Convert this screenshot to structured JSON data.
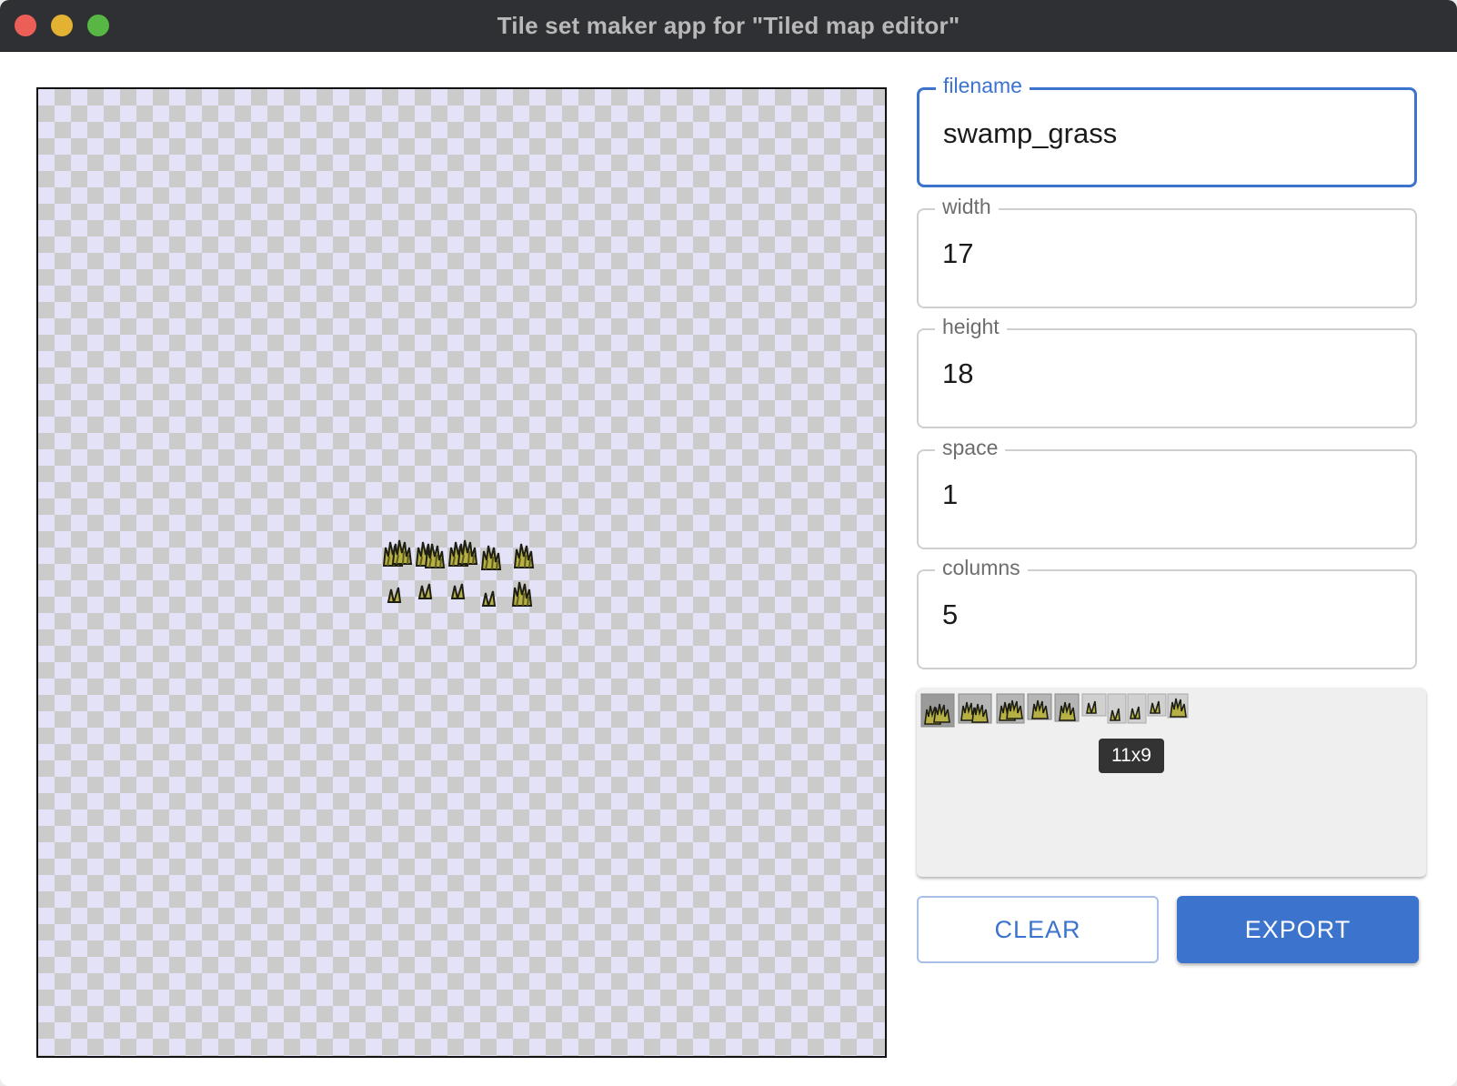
{
  "window": {
    "title": "Tile set maker app for \"Tiled map editor\""
  },
  "canvas": {
    "sprites": [
      "grass-tuft",
      "grass-tuft",
      "grass-tuft",
      "grass-tuft",
      "grass-tuft",
      "grass-sprout",
      "grass-sprout",
      "grass-sprout",
      "grass-sprout",
      "grass-tuft"
    ]
  },
  "form": {
    "filename": {
      "label": "filename",
      "value": "swamp_grass"
    },
    "width": {
      "label": "width",
      "value": "17"
    },
    "height": {
      "label": "height",
      "value": "18"
    },
    "space": {
      "label": "space",
      "value": "1"
    },
    "columns": {
      "label": "columns",
      "value": "5"
    }
  },
  "preview": {
    "tooltip": "11x9",
    "tile_count": 10
  },
  "buttons": {
    "clear": "CLEAR",
    "export": "EXPORT"
  },
  "colors": {
    "accent": "#3b73cd",
    "titlebar": "#2f3033",
    "grass_fill": "#b6b045",
    "grass_outline": "#1e1e12"
  }
}
